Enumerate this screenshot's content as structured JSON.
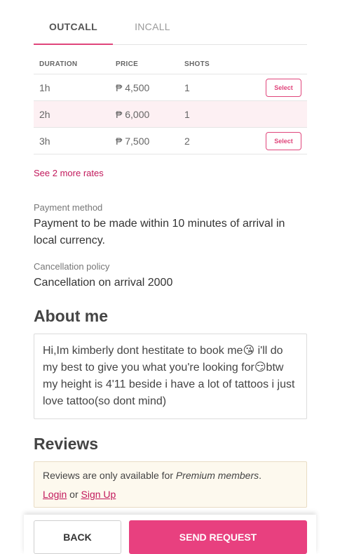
{
  "tabs": [
    {
      "label": "OUTCALL",
      "active": true
    },
    {
      "label": "INCALL",
      "active": false
    }
  ],
  "rates": {
    "headers": [
      "DURATION",
      "PRICE",
      "SHOTS"
    ],
    "rows": [
      {
        "duration": "1h",
        "price": "₱ 4,500",
        "shots": "1",
        "select_label": "Select",
        "highlight": false
      },
      {
        "duration": "2h",
        "price": "₱ 6,000",
        "shots": "1",
        "select_label": "",
        "highlight": true
      },
      {
        "duration": "3h",
        "price": "₱ 7,500",
        "shots": "2",
        "select_label": "Select",
        "highlight": false
      }
    ],
    "more_link": "See 2 more rates"
  },
  "payment": {
    "label": "Payment method",
    "value": "Payment to be made within 10 minutes of arrival in local currency."
  },
  "cancellation": {
    "label": "Cancellation policy",
    "value": "Cancellation on arrival 2000"
  },
  "about": {
    "heading": "About me",
    "text": "Hi,Im kimberly dont hestitate to book me😘 i'll do my best to give you what you're looking for😏btw my height is 4'11 beside i have a lot of tattoos i just love tattoo(so dont mind)"
  },
  "reviews": {
    "heading": "Reviews",
    "notice_prefix": "Reviews are only available for ",
    "notice_emphasis": "Premium members",
    "notice_suffix": ".",
    "login_label": "Login",
    "or_text": " or ",
    "signup_label": "Sign Up"
  },
  "actions": {
    "back_label": "BACK",
    "send_label": "SEND REQUEST"
  },
  "colors": {
    "accent": "#e8407f",
    "link": "#c2185b",
    "highlight_row": "#fdf0f3",
    "notice_bg": "#fdf9ee"
  }
}
